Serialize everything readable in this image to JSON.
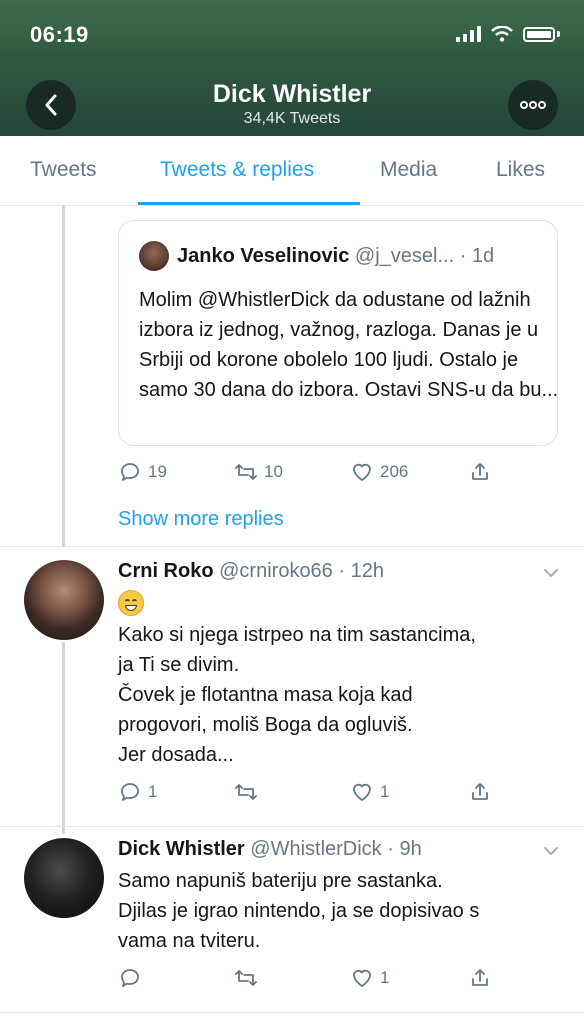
{
  "status": {
    "time": "06:19"
  },
  "header": {
    "name": "Dick Whistler",
    "tweet_count": "34,4K Tweets"
  },
  "tabs": [
    {
      "label": "Tweets"
    },
    {
      "label": "Tweets & replies"
    },
    {
      "label": "Media"
    },
    {
      "label": "Likes"
    }
  ],
  "active_tab": "Tweets & replies",
  "quoted": {
    "name": "Janko Veselinovic",
    "handle": "@j_vesel...",
    "time": "· 1d",
    "text": "Molim @WhistlerDick da odustane od lažnih izbora iz jednog, važnog, razloga. Danas je u Srbiji od korone obolelo 100 ljudi. Ostalo je samo 30 dana do izbora. Ostavi SNS-u da bu...",
    "replies": "19",
    "retweets": "10",
    "likes": "206"
  },
  "show_more": "Show more replies",
  "tweets": [
    {
      "name": "Crni Roko",
      "handle": "@crniroko66",
      "time": "· 12h",
      "emoji": "grinning-face",
      "lines": [
        "Kako si njega istrpeo na tim sastancima,",
        "ja Ti se divim.",
        "Čovek je flotantna masa koja kad",
        "progovori, moliš Boga da ogluviš.",
        "Jer dosada..."
      ],
      "replies": "1",
      "retweets": "",
      "likes": "1"
    },
    {
      "name": "Dick Whistler",
      "handle": "@WhistlerDick",
      "time": "· 9h",
      "lines": [
        "Samo napuniš bateriju pre sastanka.",
        "Djilas je igrao nintendo, ja se dopisivao s",
        "vama na tviteru."
      ],
      "replies": "",
      "retweets": "",
      "likes": "1"
    }
  ],
  "colors": {
    "accent": "#1da1f2",
    "muted": "#657786",
    "header_bg": "#2f5a40"
  }
}
